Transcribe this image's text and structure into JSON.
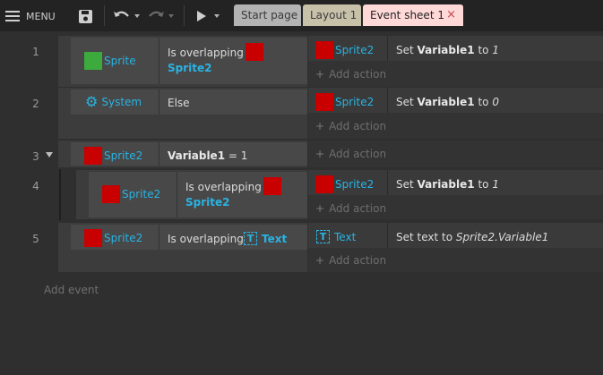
{
  "toolbar": {
    "menu_label": "MENU",
    "icons": [
      "hamburger-icon",
      "save-icon",
      "undo-icon",
      "redo-icon",
      "play-icon"
    ]
  },
  "tabs": [
    {
      "label": "Start page"
    },
    {
      "label": "Layout 1"
    },
    {
      "label": "Event sheet 1",
      "close": "×",
      "active": true
    }
  ],
  "events": [
    {
      "number": "1",
      "condition": {
        "object": "Sprite",
        "text": "Is overlapping",
        "target": "Sprite2"
      },
      "action": {
        "object": "Sprite2",
        "text_prefix": "Set",
        "variable": "Variable1",
        "text_mid": "to",
        "value": "1"
      },
      "add_action": "Add action"
    },
    {
      "number": "2",
      "condition": {
        "object": "System",
        "text": "Else"
      },
      "action": {
        "object": "Sprite2",
        "text_prefix": "Set",
        "variable": "Variable1",
        "text_mid": "to",
        "value": "0"
      },
      "add_action": "Add action"
    },
    {
      "number": "3",
      "condition": {
        "object": "Sprite2",
        "variable": "Variable1",
        "compare": "= 1"
      },
      "add_action": "Add action"
    },
    {
      "number": "4",
      "condition": {
        "object": "Sprite2",
        "text": "Is overlapping",
        "target": "Sprite2"
      },
      "action": {
        "object": "Sprite2",
        "text_prefix": "Set",
        "variable": "Variable1",
        "text_mid": "to",
        "value": "1"
      },
      "add_action": "Add action"
    },
    {
      "number": "5",
      "condition": {
        "object": "Sprite2",
        "text": "Is overlapping",
        "target": "Text"
      },
      "action": {
        "object": "Text",
        "text_prefix": "Set text to",
        "value": "Sprite2.Variable1"
      },
      "add_action": "Add action"
    }
  ],
  "add_event": "Add event",
  "colors": {
    "object_link": "#29b3e3",
    "sprite_red": "#c80000",
    "sprite_green": "#3caa3c",
    "active_tab": "#ffd8d8"
  }
}
